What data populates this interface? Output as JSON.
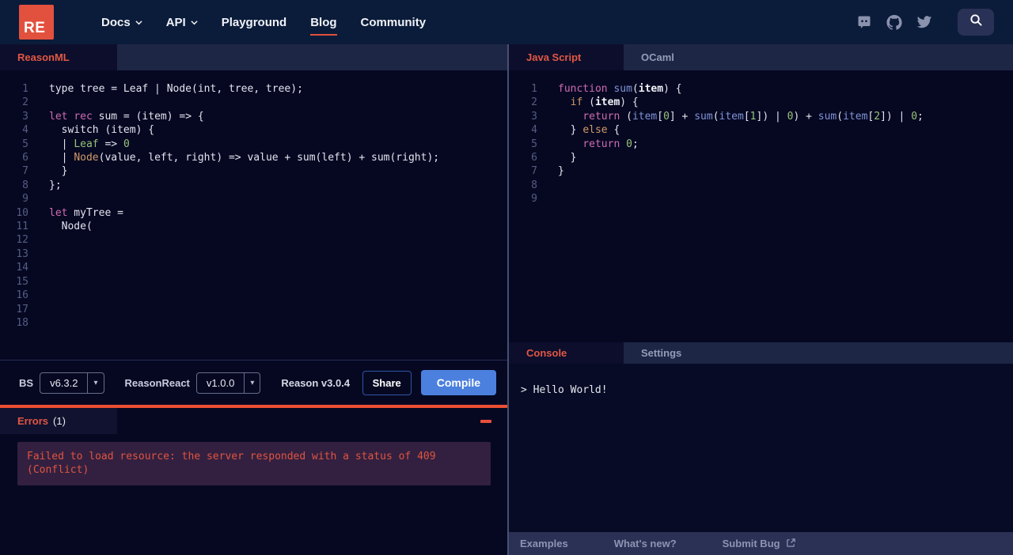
{
  "nav": {
    "logo": "RE",
    "items": [
      {
        "label": "Docs"
      },
      {
        "label": "API"
      },
      {
        "label": "Playground"
      },
      {
        "label": "Blog"
      },
      {
        "label": "Community"
      }
    ],
    "icons": [
      "discord-icon",
      "github-icon",
      "twitter-icon",
      "search-icon"
    ]
  },
  "colors": {
    "accent_red": "#ea4e31",
    "tab_active_text": "#e25743",
    "logo_red": "#e2513e",
    "compile_blue": "#4c80de",
    "error_box_bg": "#332041"
  },
  "left": {
    "tab_label": "ReasonML",
    "code": [
      [
        [
          "pl",
          "type tree = Leaf | Node(int, tree, tree);"
        ]
      ],
      [],
      [
        [
          "kw",
          "let"
        ],
        [
          "pl",
          " "
        ],
        [
          "kw",
          "rec"
        ],
        [
          "pl",
          " sum = (item) => {"
        ]
      ],
      [
        [
          "pl",
          "  switch (item) {"
        ]
      ],
      [
        [
          "pl",
          "  | "
        ],
        [
          "grn",
          "Leaf"
        ],
        [
          "pl",
          " => "
        ],
        [
          "num",
          "0"
        ]
      ],
      [
        [
          "pl",
          "  | "
        ],
        [
          "orn",
          "Node"
        ],
        [
          "pl",
          "(value, left, right) => value + sum(left) + sum(right);"
        ]
      ],
      [
        [
          "pl",
          "  }"
        ]
      ],
      [
        [
          "pl",
          "};"
        ]
      ],
      [],
      [
        [
          "kw",
          "let"
        ],
        [
          "pl",
          " myTree ="
        ]
      ],
      [
        [
          "pl",
          "  Node("
        ]
      ],
      [],
      [],
      [],
      [],
      [],
      [],
      []
    ],
    "toolbar": {
      "bs_label": "BS",
      "bs_version": "v6.3.2",
      "reasonreact_label": "ReasonReact",
      "reasonreact_version": "v1.0.0",
      "reason_version": "Reason v3.0.4",
      "share_label": "Share",
      "compile_label": "Compile"
    },
    "errors": {
      "title": "Errors",
      "count": "(1)",
      "message": "Failed to load resource: the server responded with a status of 409 (Conflict)"
    }
  },
  "right": {
    "tabs": {
      "javascript": "Java Script",
      "ocaml": "OCaml"
    },
    "code": [
      [
        [
          "kw",
          "function"
        ],
        [
          "pl",
          " "
        ],
        [
          "id",
          "sum"
        ],
        [
          "pl",
          "("
        ],
        [
          "plb",
          "item"
        ],
        [
          "pl",
          ") {"
        ]
      ],
      [
        [
          "pl",
          "  "
        ],
        [
          "orn",
          "if"
        ],
        [
          "pl",
          " ("
        ],
        [
          "plb",
          "item"
        ],
        [
          "pl",
          ") {"
        ]
      ],
      [
        [
          "pl",
          "    "
        ],
        [
          "kw",
          "return"
        ],
        [
          "pl",
          " ("
        ],
        [
          "id",
          "item"
        ],
        [
          "pl",
          "["
        ],
        [
          "num",
          "0"
        ],
        [
          "pl",
          "] + "
        ],
        [
          "id",
          "sum"
        ],
        [
          "pl",
          "("
        ],
        [
          "id",
          "item"
        ],
        [
          "pl",
          "["
        ],
        [
          "num",
          "1"
        ],
        [
          "pl",
          "]) | "
        ],
        [
          "num",
          "0"
        ],
        [
          "pl",
          ") + "
        ],
        [
          "id",
          "sum"
        ],
        [
          "pl",
          "("
        ],
        [
          "id",
          "item"
        ],
        [
          "pl",
          "["
        ],
        [
          "num",
          "2"
        ],
        [
          "pl",
          "]) | "
        ],
        [
          "num",
          "0"
        ],
        [
          "pl",
          ";"
        ]
      ],
      [
        [
          "pl",
          "  } "
        ],
        [
          "orn",
          "else"
        ],
        [
          "pl",
          " {"
        ]
      ],
      [
        [
          "pl",
          "    "
        ],
        [
          "kw",
          "return"
        ],
        [
          "pl",
          " "
        ],
        [
          "num",
          "0"
        ],
        [
          "pl",
          ";"
        ]
      ],
      [
        [
          "pl",
          "  }"
        ]
      ],
      [
        [
          "pl",
          "}"
        ]
      ],
      [],
      []
    ],
    "console": {
      "tab_console": "Console",
      "tab_settings": "Settings",
      "output": "> Hello World!"
    },
    "footer": {
      "examples": "Examples",
      "whats_new": "What's new?",
      "submit_bug": "Submit Bug"
    }
  }
}
